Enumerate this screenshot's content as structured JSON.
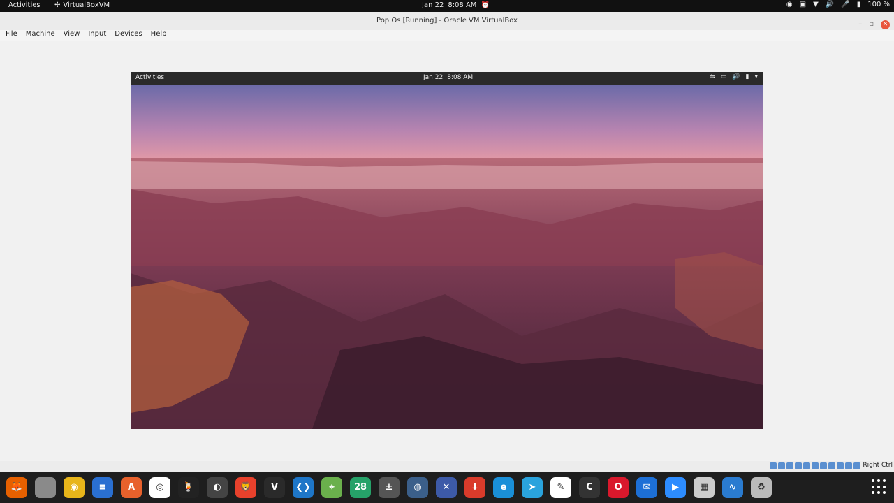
{
  "host_topbar": {
    "activities": "Activities",
    "app_name": "VirtualBoxVM",
    "date": "Jan 22",
    "time": "8:08 AM",
    "battery": "100 %"
  },
  "window": {
    "title": "Pop Os [Running] - Oracle VM VirtualBox"
  },
  "menubar": {
    "items": [
      "File",
      "Machine",
      "View",
      "Input",
      "Devices",
      "Help"
    ]
  },
  "guest": {
    "activities": "Activities",
    "date": "Jan 22",
    "time": "8:08 AM"
  },
  "statusbar": {
    "host_key": "Right Ctrl"
  },
  "dock": {
    "apps": [
      {
        "name": "firefox",
        "color": "#e66000",
        "glyph": "🦊"
      },
      {
        "name": "files",
        "color": "#8a8a8a",
        "glyph": ""
      },
      {
        "name": "rhythmbox",
        "color": "#e8b51a",
        "glyph": "◉"
      },
      {
        "name": "writer",
        "color": "#2a6fd1",
        "glyph": "≡"
      },
      {
        "name": "software",
        "color": "#e8612c",
        "glyph": "A"
      },
      {
        "name": "chrome",
        "color": "#ffffff",
        "glyph": "◎"
      },
      {
        "name": "cocktail",
        "color": "#222222",
        "glyph": "🍹"
      },
      {
        "name": "obs",
        "color": "#444444",
        "glyph": "◐"
      },
      {
        "name": "brave",
        "color": "#e8412c",
        "glyph": "🦁"
      },
      {
        "name": "vivaldi",
        "color": "#2a2a2a",
        "glyph": "V"
      },
      {
        "name": "vscode",
        "color": "#1e76c8",
        "glyph": "❮❯"
      },
      {
        "name": "maps",
        "color": "#6ab04c",
        "glyph": "⌖"
      },
      {
        "name": "calendar",
        "color": "#26a269",
        "glyph": "28"
      },
      {
        "name": "calculator",
        "color": "#555555",
        "glyph": "±"
      },
      {
        "name": "globe",
        "color": "#3b5f8a",
        "glyph": "◍"
      },
      {
        "name": "xmind",
        "color": "#3d5aa8",
        "glyph": "✕"
      },
      {
        "name": "download",
        "color": "#d93b2b",
        "glyph": "⬇"
      },
      {
        "name": "edge",
        "color": "#1a8fd8",
        "glyph": "e"
      },
      {
        "name": "telegram",
        "color": "#2aa3dd",
        "glyph": "➤"
      },
      {
        "name": "editor",
        "color": "#ffffff",
        "glyph": "✎"
      },
      {
        "name": "cursor",
        "color": "#333333",
        "glyph": "C"
      },
      {
        "name": "opera",
        "color": "#d9182c",
        "glyph": "O"
      },
      {
        "name": "mail",
        "color": "#1d6fd6",
        "glyph": "✉"
      },
      {
        "name": "zoom",
        "color": "#2d8cff",
        "glyph": "▶"
      },
      {
        "name": "image-viewer",
        "color": "#cccccc",
        "glyph": "▦"
      },
      {
        "name": "monitor",
        "color": "#2a7bd0",
        "glyph": "∿"
      },
      {
        "name": "trash",
        "color": "#bbbbbb",
        "glyph": "♻"
      }
    ]
  },
  "colors": {
    "close_button": "#e8553d",
    "dock_bg": "#1e1e1e",
    "topbar_bg": "#111111"
  }
}
